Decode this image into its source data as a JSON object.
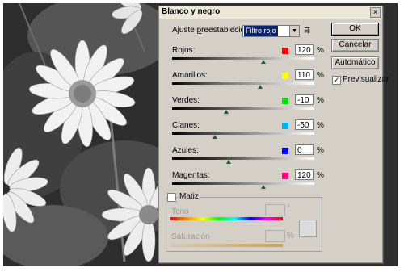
{
  "dialog": {
    "title": "Blanco y negro",
    "close_glyph": "×",
    "preset": {
      "label_prefix": "Ajuste ",
      "label_accel": "p",
      "label_suffix": "reestablecido:",
      "value": "Filtro rojo",
      "arrow_glyph": "▼",
      "menu_glyph": "⇶"
    },
    "buttons": {
      "ok": "OK",
      "cancel": "Cancelar",
      "auto": "Automático"
    },
    "preview": {
      "label": "Previsualizar",
      "checked": true,
      "check_glyph": "✓"
    },
    "percent_sign": "%",
    "sliders": [
      {
        "label": "Rojos:",
        "value": "120",
        "swatch": "#ff0000",
        "level_pct": 120
      },
      {
        "label": "Amarillos:",
        "value": "110",
        "swatch": "#ffff00",
        "level_pct": 110
      },
      {
        "label": "Verdes:",
        "value": "-10",
        "swatch": "#00e000",
        "level_pct": -10
      },
      {
        "label": "Cianes:",
        "value": "-50",
        "swatch": "#00b0f0",
        "level_pct": -50
      },
      {
        "label": "Azules:",
        "value": "0",
        "swatch": "#0000ff",
        "level_pct": 0
      },
      {
        "label": "Magentas:",
        "value": "120",
        "swatch": "#ff0080",
        "level_pct": 120
      }
    ],
    "tint": {
      "label": "Matiz",
      "checked": false,
      "tone_label": "Tono",
      "degree_sign": "°",
      "saturation_label": "Saturación",
      "sat_unit": "%"
    }
  }
}
